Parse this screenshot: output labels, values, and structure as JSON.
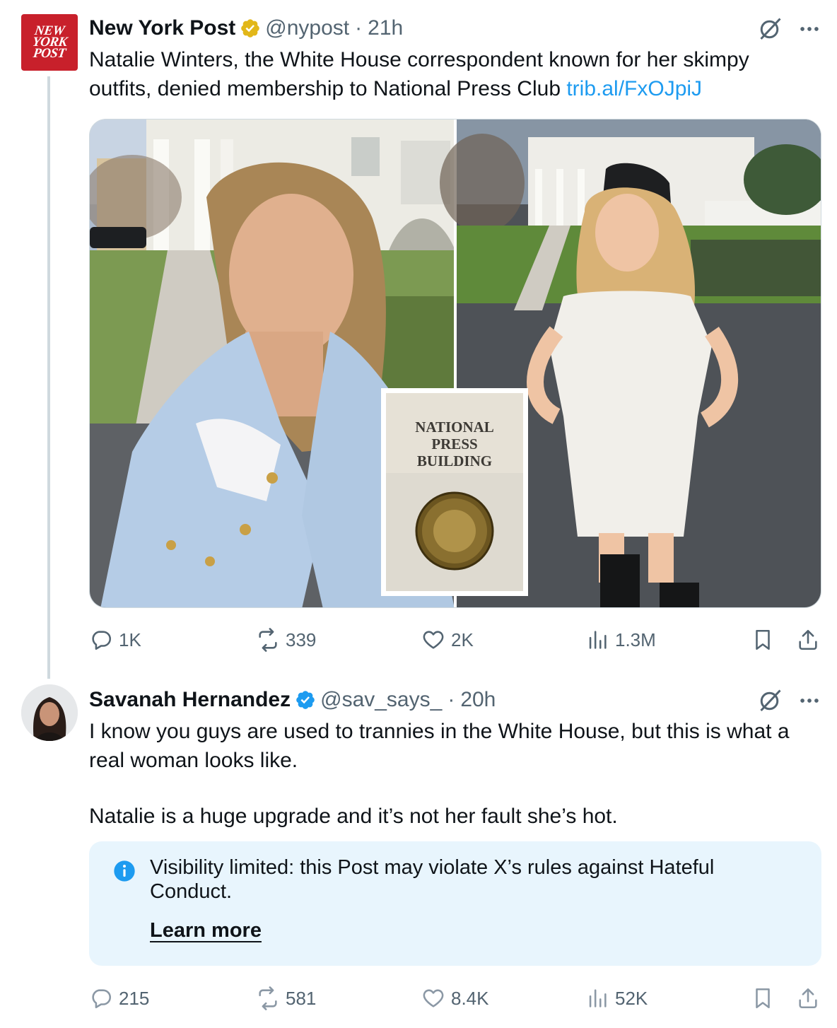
{
  "tweet1": {
    "avatar_text": [
      "NEW",
      "YORK",
      "POST"
    ],
    "name": "New York Post",
    "handle": "@nypost",
    "separator": "·",
    "time": "21h",
    "text": "Natalie Winters, the White House correspondent known for her skimpy outfits, denied membership to National Press Club ",
    "link": "trib.al/FxOJpiJ",
    "inset_sign": [
      "NATIONAL",
      "PRESS",
      "BUILDING"
    ],
    "actions": {
      "replies": "1K",
      "reposts": "339",
      "likes": "2K",
      "views": "1.3M"
    }
  },
  "tweet2": {
    "name": "Savanah Hernandez",
    "handle": "@sav_says_",
    "separator": "·",
    "time": "20h",
    "text_p1": "I know you guys are used to trannies in the White House, but this is what a real woman looks like.",
    "text_p2": "Natalie is a huge upgrade and it’s not her fault she’s hot.",
    "notice": {
      "text": "Visibility limited: this Post may violate X’s rules against Hateful Conduct.",
      "link": "Learn more"
    },
    "actions": {
      "replies": "215",
      "reposts": "581",
      "likes": "8.4K",
      "views": "52K"
    }
  },
  "colors": {
    "accent": "#1d9bf0",
    "gold_badge": "#e2b719",
    "blue_badge": "#1d9bf0",
    "nyp_red": "#c8202b",
    "muted": "#536471",
    "notice_bg": "#e8f5fd"
  },
  "icons": [
    "reply-icon",
    "repost-icon",
    "like-icon",
    "views-icon",
    "bookmark-icon",
    "share-icon",
    "grok-icon",
    "more-icon",
    "verified-badge-icon",
    "info-icon"
  ]
}
